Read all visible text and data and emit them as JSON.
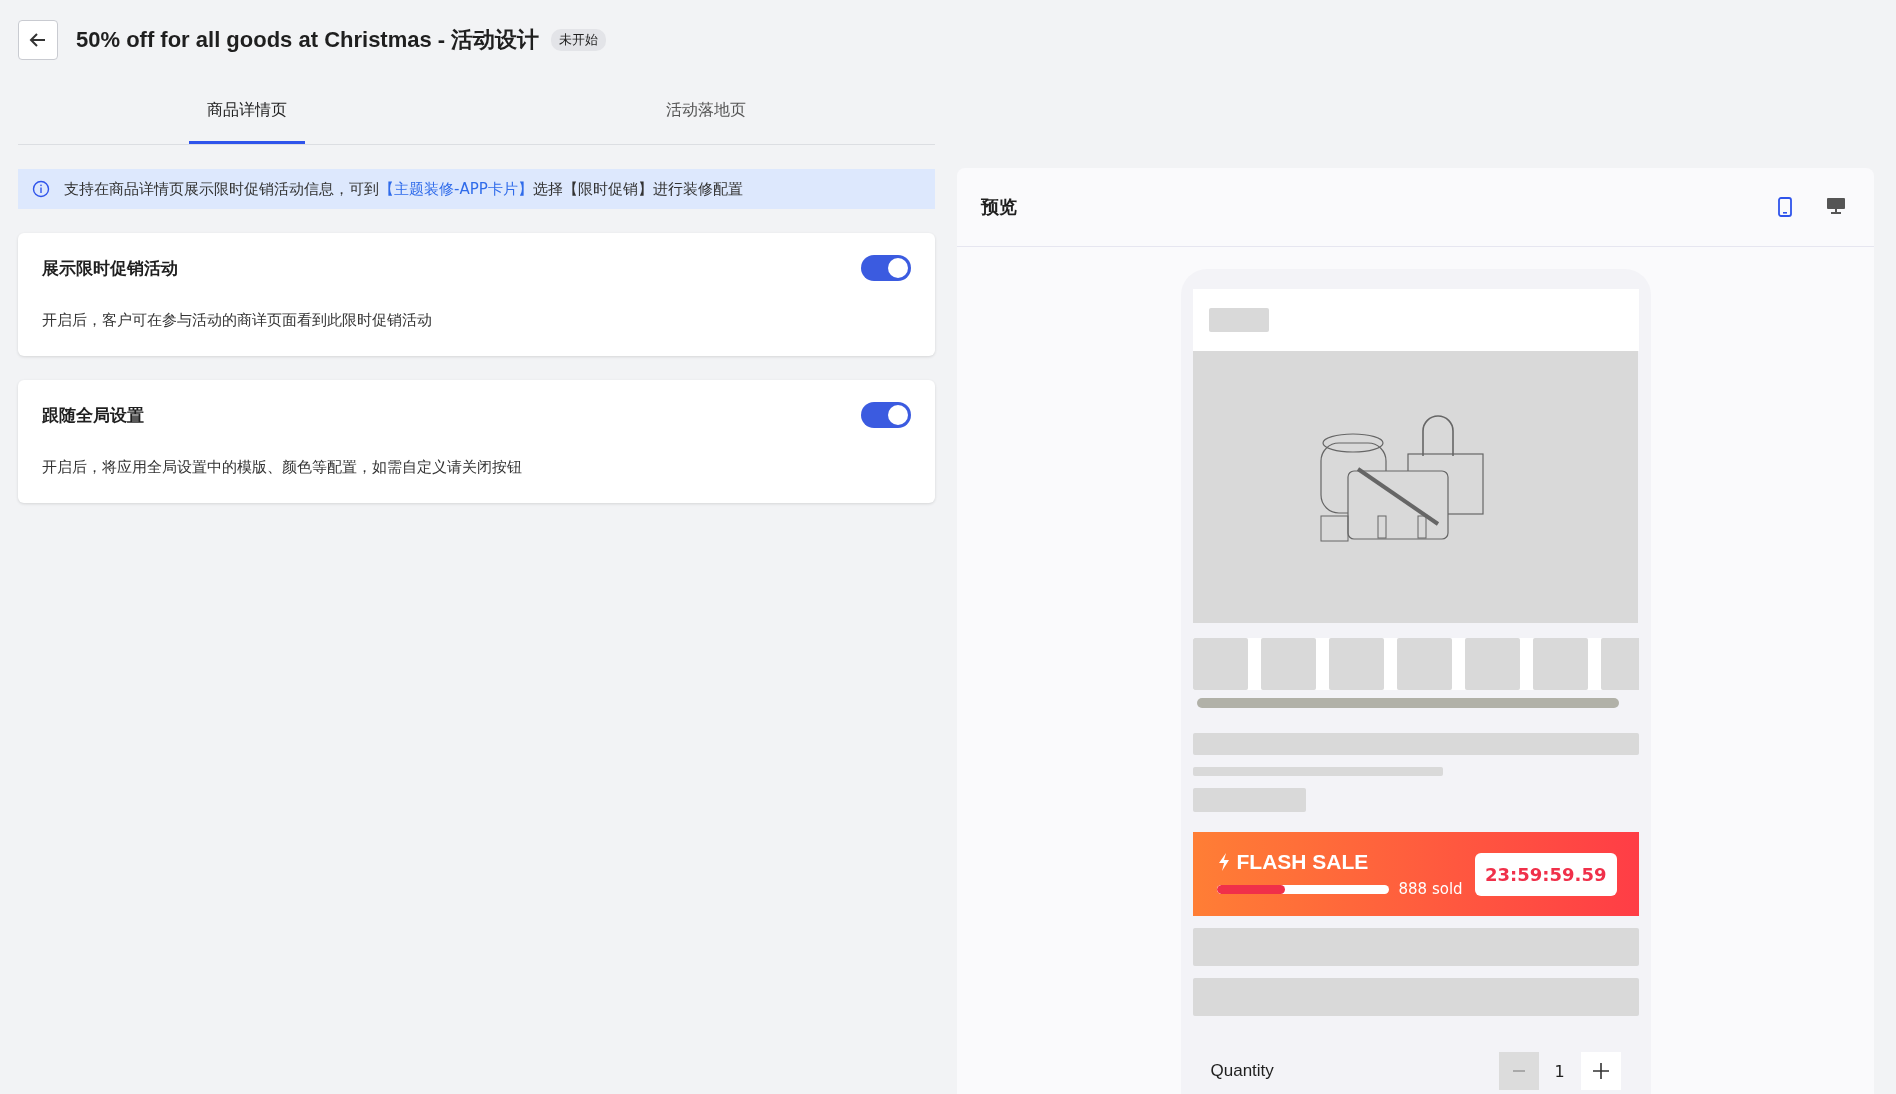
{
  "header": {
    "title": "50% off for all goods at Christmas - 活动设计",
    "status": "未开始"
  },
  "tabs": [
    {
      "label": "商品详情页",
      "selected": true
    },
    {
      "label": "活动落地页",
      "selected": false
    }
  ],
  "notice": {
    "before": "支持在商品详情页展示限时促销活动信息，可到",
    "link": "【主题装修-APP卡片】",
    "after": "选择【限时促销】进行装修配置"
  },
  "settings": [
    {
      "title": "展示限时促销活动",
      "description": "开启后，客户可在参与活动的商详页面看到此限时促销活动",
      "on": true
    },
    {
      "title": "跟随全局设置",
      "description": "开启后，将应用全局设置中的模版、颜色等配置，如需自定义请关闭按钮",
      "on": true
    }
  ],
  "preview": {
    "title": "预览",
    "devices": [
      {
        "kind": "mobile",
        "selected": true
      },
      {
        "kind": "desktop",
        "selected": false
      }
    ],
    "flash_sale": {
      "label": "FLASH SALE",
      "level": 0.4,
      "sold": "888 sold",
      "countdown": "23:59:59.59"
    },
    "quantity": {
      "label": "Quantity",
      "value": "1",
      "minus_disabled": true
    }
  }
}
